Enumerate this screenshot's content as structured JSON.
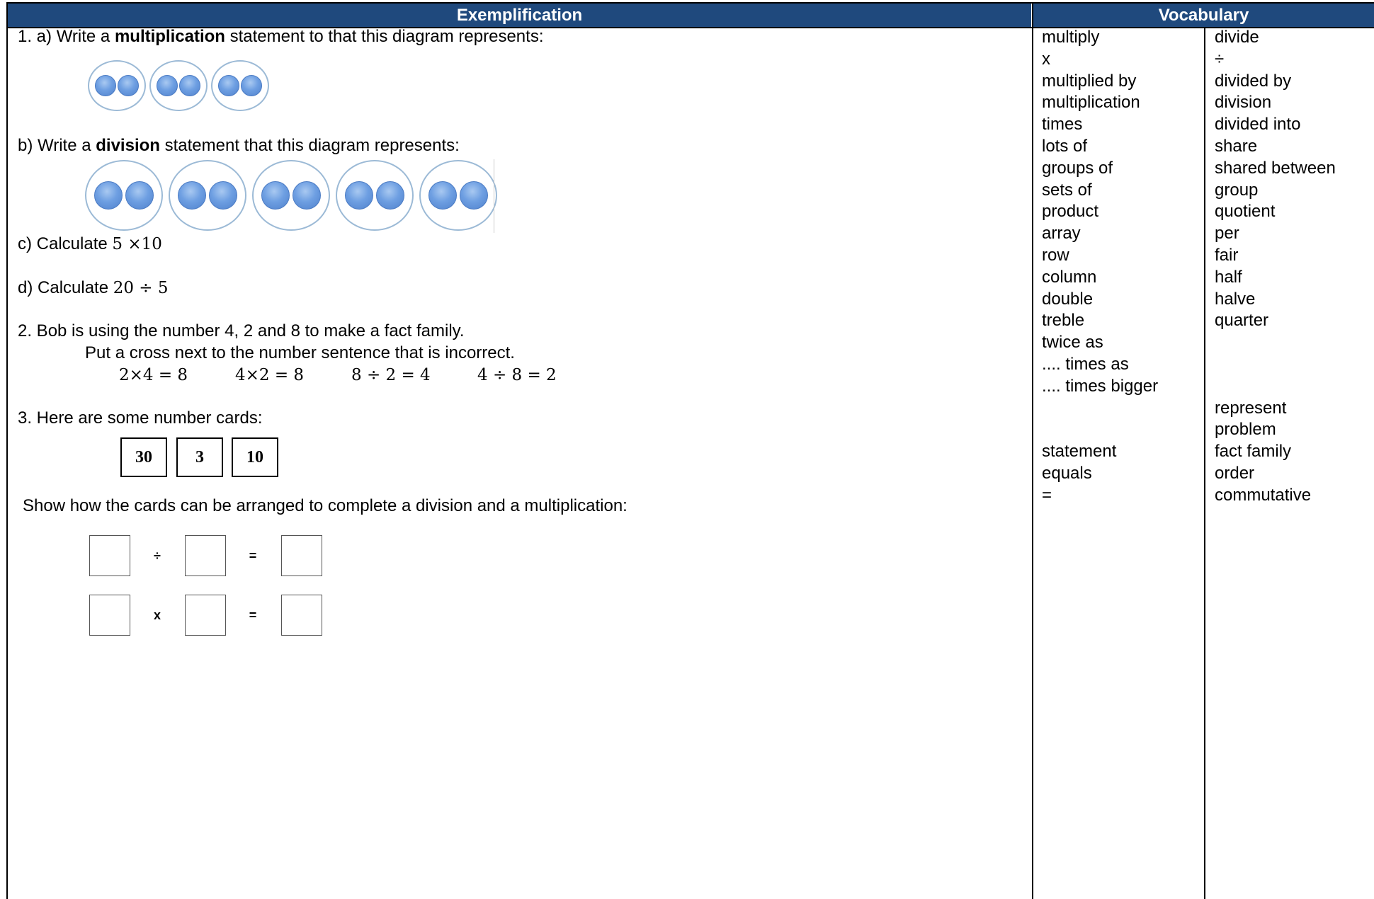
{
  "headers": {
    "left": "Exemplification",
    "right": "Vocabulary"
  },
  "q1": {
    "a_pre": "1.  a) Write a ",
    "a_bold": "multiplication",
    "a_post": " statement to that this diagram represents:",
    "b_pre": "b) Write a ",
    "b_bold": "division",
    "b_post": " statement that this diagram represents:",
    "c_text": "c) Calculate ",
    "c_math": "5 ×10",
    "d_text": "d) Calculate ",
    "d_math": "20 ÷ 5",
    "groups_a": 3,
    "groups_b": 5,
    "counters_per_group": 2
  },
  "q2": {
    "line1": "2. Bob is using the number 4, 2 and 8 to make a fact family.",
    "line2": "Put a cross next to the number sentence that is incorrect.",
    "sentences": [
      "2×4 = 8",
      "4×2 = 8",
      "8 ÷ 2 = 4",
      "4 ÷ 8 = 2"
    ]
  },
  "q3": {
    "line1": "3. Here are some number cards:",
    "cards": [
      "30",
      "3",
      "10"
    ],
    "line2": "Show how the cards can be arranged to complete a division and a multiplication:",
    "row1_ops": [
      "÷",
      "="
    ],
    "row2_ops": [
      "x",
      "="
    ]
  },
  "vocab_col1": [
    "multiply",
    "x",
    "multiplied by",
    "multiplication",
    "times",
    "lots of",
    "groups of",
    "sets of",
    "product",
    "array",
    "row",
    "column",
    "double",
    "treble",
    "twice as",
    ".... times as",
    ".... times bigger",
    "",
    "",
    "statement",
    "equals",
    "="
  ],
  "vocab_col2": [
    "divide",
    "÷",
    "divided by",
    "division",
    "divided into",
    "share",
    "shared between",
    "group",
    "quotient",
    "per",
    "fair",
    "half",
    "halve",
    "quarter",
    "",
    "",
    "",
    "represent",
    "problem",
    "fact family",
    "order",
    "commutative"
  ],
  "colors": {
    "header_bg": "#1f497d",
    "counter": "#6e9fe2",
    "group_border": "#9cbad6"
  }
}
